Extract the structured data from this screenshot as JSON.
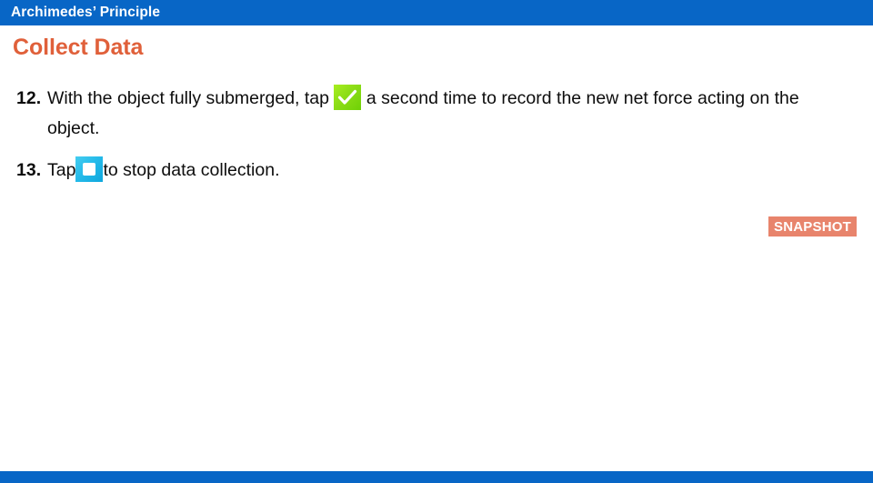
{
  "header": {
    "title": "Archimedes’ Principle",
    "bar_color": "#0866c6",
    "text_color": "#ffffff"
  },
  "section": {
    "heading": "Collect Data",
    "heading_color": "#e0603a"
  },
  "steps": [
    {
      "number": "12.",
      "text_before_icon": "With the object fully submerged, tap ",
      "icon": "green-check-icon",
      "icon_colors": {
        "start": "#a8ef20",
        "end": "#6fd106",
        "glyph": "#ffffff"
      },
      "text_after_icon": " a second time to record the new net force acting on the object."
    },
    {
      "number": "13.",
      "text_before_icon": "Tap",
      "icon": "blue-stop-icon",
      "icon_colors": {
        "start": "#45cdf0",
        "end": "#0fa7dd",
        "glyph": "#ffffff"
      },
      "text_after_icon": "to stop data collection."
    }
  ],
  "badge": {
    "label": "SNAPSHOT",
    "background": "#e8846c",
    "text_color": "#ffffff"
  },
  "footer": {
    "bar_color": "#0866c6"
  }
}
